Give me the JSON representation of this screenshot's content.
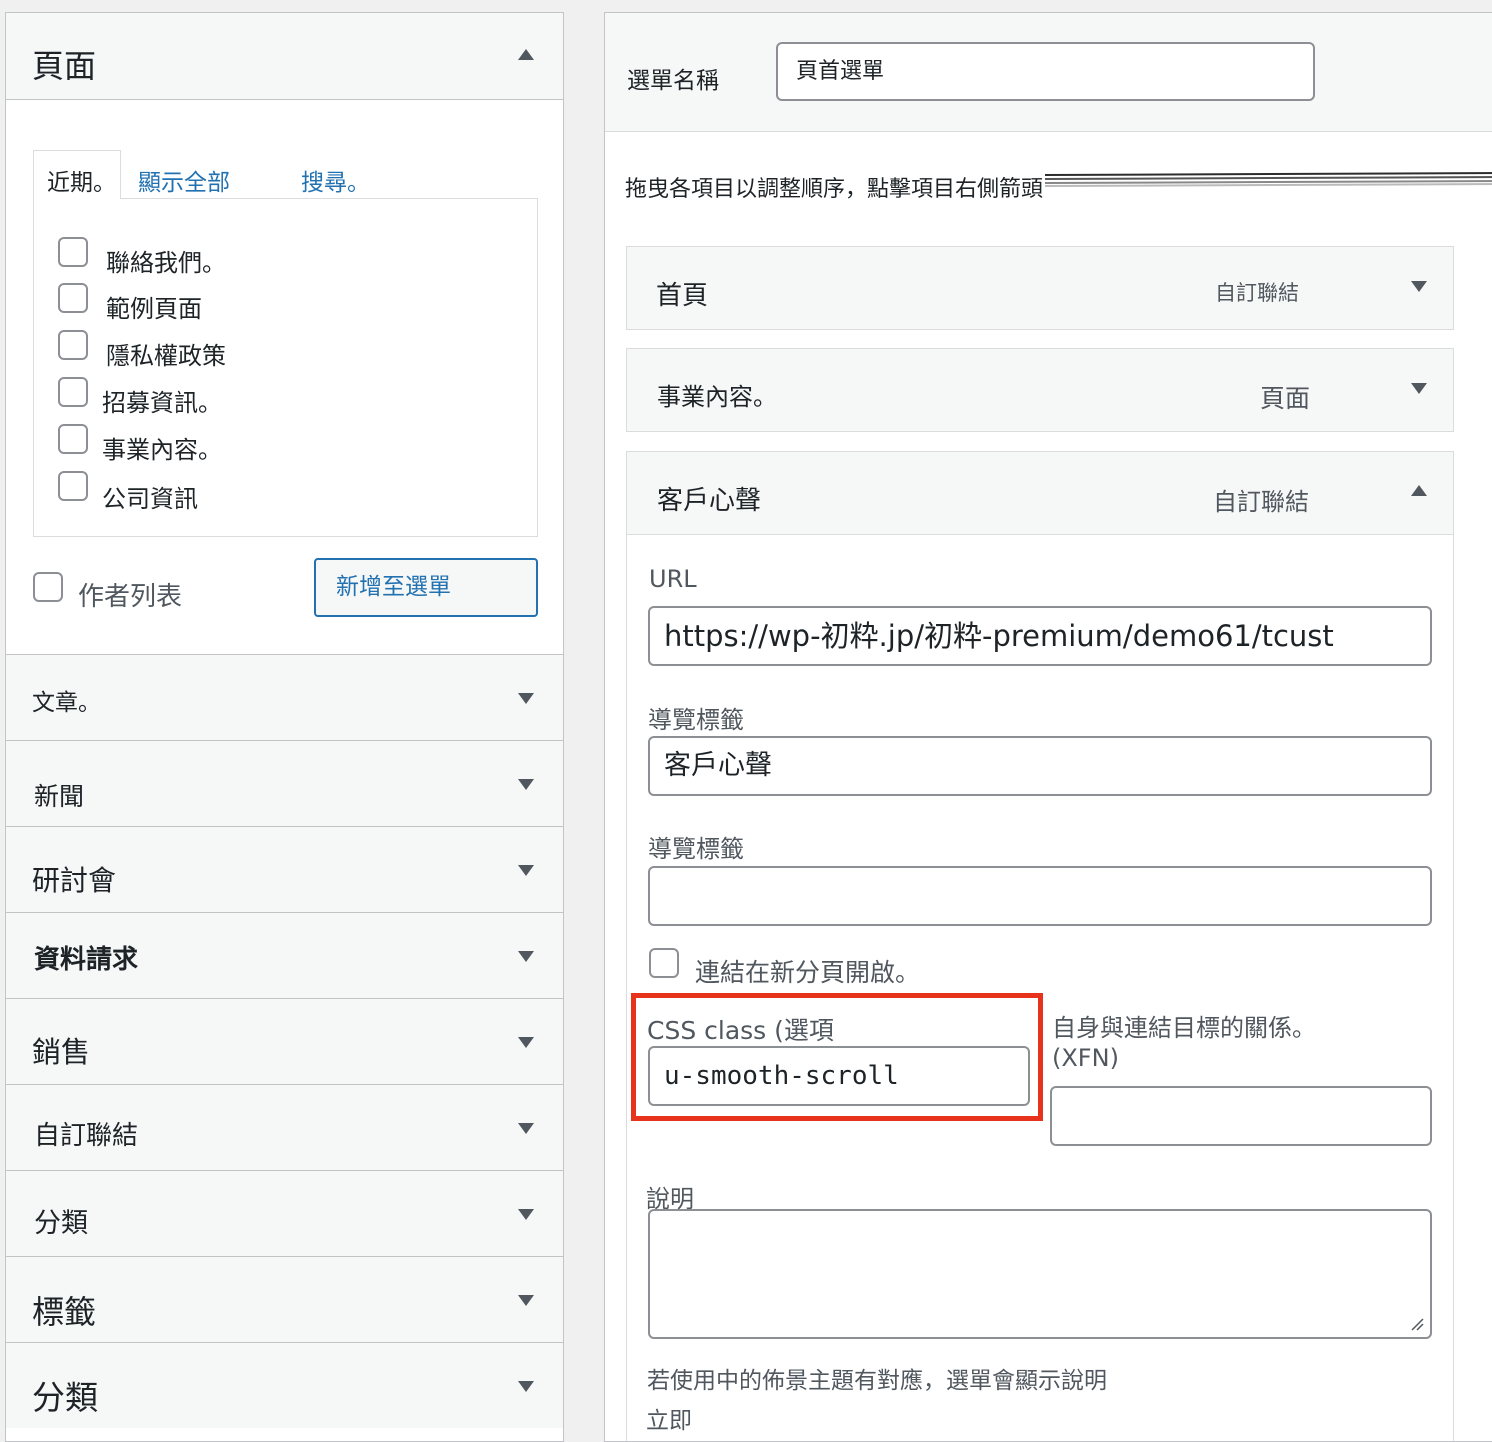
{
  "left": {
    "section_title": "頁面",
    "tabs": {
      "recent": "近期。",
      "view_all": "顯示全部",
      "search": "搜尋。"
    },
    "pages": [
      "聯絡我們。",
      "範例頁面",
      "隱私權政策",
      "招募資訊。",
      "事業內容。",
      "公司資訊"
    ],
    "author_list": "作者列表",
    "add_to_menu": "新增至選單",
    "accordions": [
      "文章。",
      "新聞",
      "研討會",
      "資料請求",
      "銷售",
      "自訂聯結",
      "分類",
      "標籤",
      "分類"
    ]
  },
  "right": {
    "menu_name_label": "選單名稱",
    "menu_name_value": "頁首選單",
    "instructions": "拖曳各項目以調整順序，點擊項目右側箭頭",
    "items": [
      {
        "title": "首頁",
        "type": "自訂聯結"
      },
      {
        "title": "事業內容。",
        "type": "頁面"
      },
      {
        "title": "客戶心聲",
        "type": "自訂聯結"
      }
    ],
    "fields": {
      "url_label": "URL",
      "url_value": "https://wp-初粋.jp/初粋-premium/demo61/tcust",
      "nav_label_label": "導覽標籤",
      "nav_label_value": "客戶心聲",
      "title_attr_label": "導覽標籤",
      "title_attr_value": "",
      "new_tab_label": "連結在新分頁開啟。",
      "css_class_label": "CSS class (選項",
      "css_class_value": "u-smooth-scroll",
      "xfn_label_1": "自身與連結目標的關係。",
      "xfn_label_2": "(XFN)",
      "xfn_value": "",
      "description_label": "說明",
      "description_value": "",
      "description_note": "若使用中的佈景主題有對應，選單會顯示說明",
      "bottom_text": "立即"
    }
  },
  "colors": {
    "accent": "#2271b1",
    "highlight": "#e8331c",
    "panel_bg": "#f6f7f7",
    "border": "#c3c4c7"
  }
}
